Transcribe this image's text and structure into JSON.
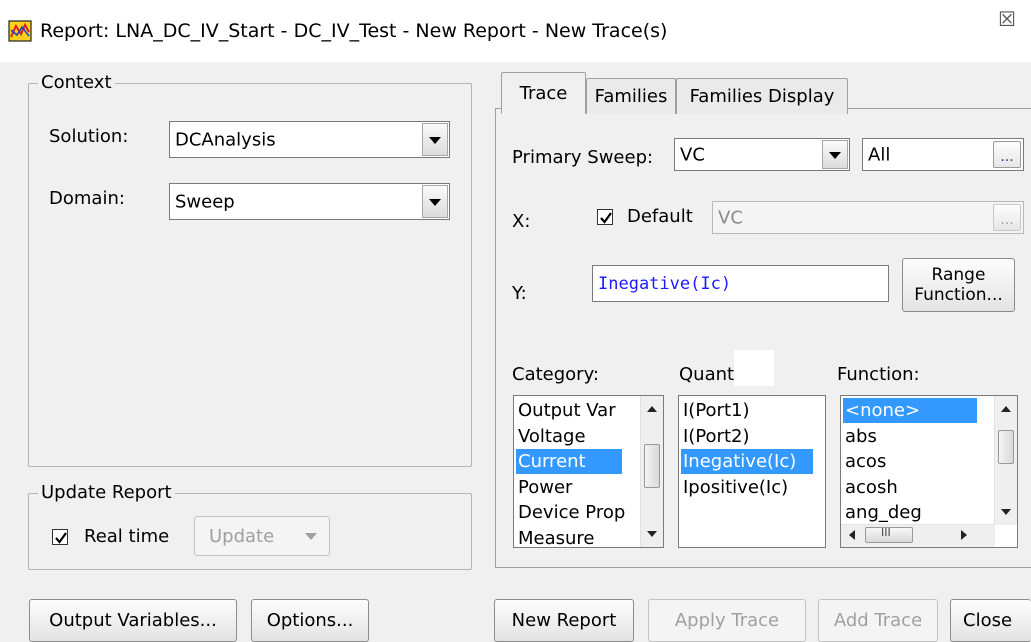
{
  "window": {
    "title": "Report: LNA_DC_IV_Start - DC_IV_Test - New Report - New Trace(s)",
    "close_glyph": "☒"
  },
  "context": {
    "legend": "Context",
    "solution_label": "Solution:",
    "solution_value": "DCAnalysis",
    "domain_label": "Domain:",
    "domain_value": "Sweep"
  },
  "update_report": {
    "legend": "Update Report",
    "realtime_label": "Real time",
    "realtime_checked": true,
    "update_button": "Update"
  },
  "tabs": [
    {
      "label": "Trace",
      "active": true
    },
    {
      "label": "Families",
      "active": false
    },
    {
      "label": "Families Display",
      "active": false
    }
  ],
  "trace": {
    "primary_sweep_label": "Primary Sweep:",
    "primary_sweep_value": "VC",
    "sweep_range_value": "All",
    "ellipsis": "...",
    "x_label": "X:",
    "default_label": "Default",
    "default_checked": true,
    "x_value": "VC",
    "y_label": "Y:",
    "y_value": "Inegative(Ic)",
    "range_function_line1": "Range",
    "range_function_line2": "Function...",
    "category_label": "Category:",
    "quantity_label": "Quant",
    "function_label": "Function:",
    "category_items": [
      "Output Var",
      "Voltage",
      "Current",
      "Power",
      "Device Prop",
      "Measure"
    ],
    "category_selected": "Current",
    "quantity_items": [
      "I(Port1)",
      "I(Port2)",
      "Inegative(Ic)",
      "Ipositive(Ic)"
    ],
    "quantity_selected": "Inegative(Ic)",
    "function_items": [
      "<none>",
      "abs",
      "acos",
      "acosh",
      "ang_deg"
    ],
    "function_selected": "<none>",
    "hscroll_grip": "III"
  },
  "buttons": {
    "output_variables": "Output Variables...",
    "options": "Options...",
    "new_report": "New Report",
    "apply_trace": "Apply Trace",
    "add_trace": "Add Trace",
    "close": "Close"
  },
  "colors": {
    "selection": "#3399ff",
    "y_text": "#1a1aff",
    "window_bg": "#f0f0f0"
  }
}
